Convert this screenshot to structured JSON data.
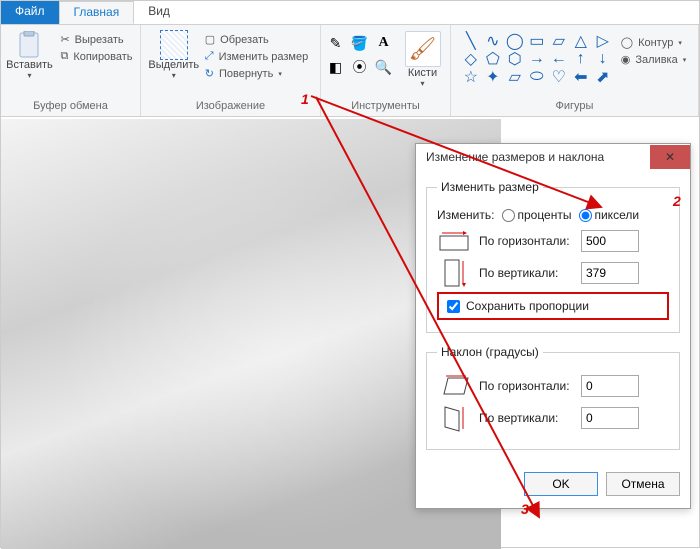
{
  "tabs": {
    "file": "Файл",
    "home": "Главная",
    "view": "Вид"
  },
  "ribbon": {
    "clipboard": {
      "title": "Буфер обмена",
      "paste": "Вставить",
      "cut": "Вырезать",
      "copy": "Копировать"
    },
    "image": {
      "title": "Изображение",
      "select": "Выделить",
      "crop": "Обрезать",
      "resize": "Изменить размер",
      "rotate": "Повернуть"
    },
    "tools": {
      "title": "Инструменты",
      "brushes": "Кисти"
    },
    "shapes": {
      "title": "Фигуры",
      "outline": "Контур",
      "fill": "Заливка"
    }
  },
  "dialog": {
    "title": "Изменение размеров и наклона",
    "resize_legend": "Изменить размер",
    "change_by": "Изменить:",
    "percent": "проценты",
    "pixels": "пиксели",
    "horizontal": "По горизонтали:",
    "vertical": "По вертикали:",
    "keep_ratio": "Сохранить пропорции",
    "skew_legend": "Наклон (градусы)",
    "ok": "OK",
    "cancel": "Отмена",
    "vals": {
      "h": "500",
      "v": "379",
      "sh": "0",
      "sv": "0"
    }
  },
  "markers": {
    "m1": "1",
    "m2": "2",
    "m3": "3"
  }
}
